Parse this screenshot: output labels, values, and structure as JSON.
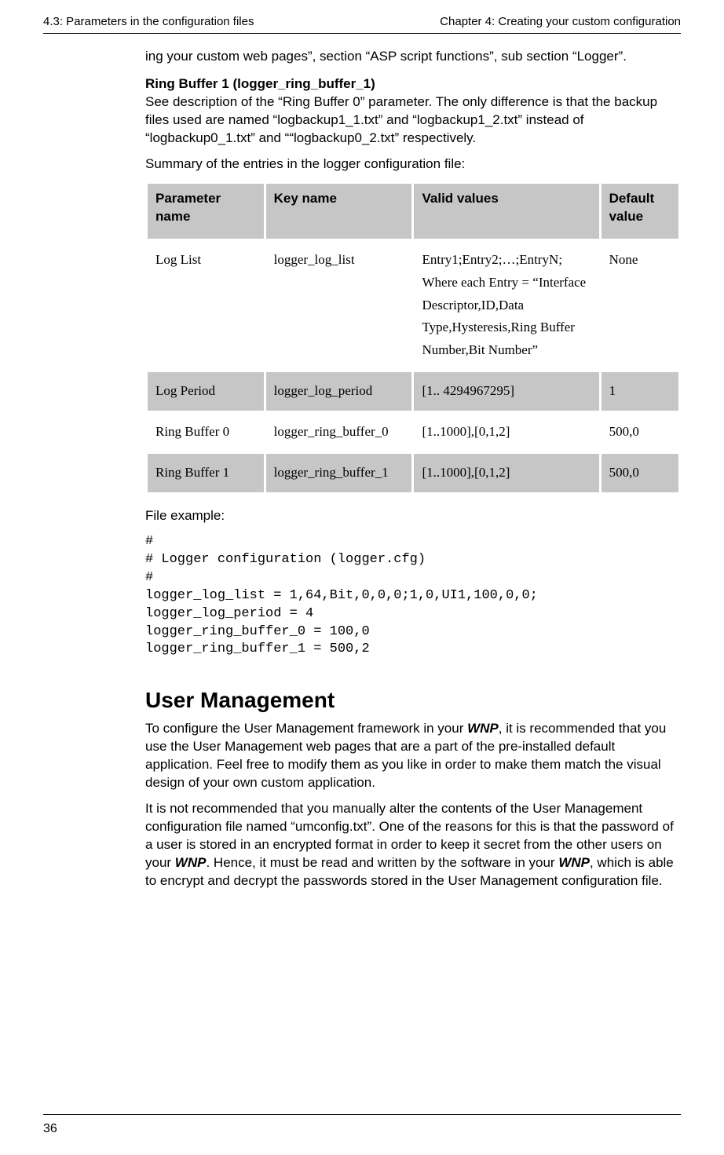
{
  "header": {
    "left": "4.3: Parameters in the configuration files",
    "right": "Chapter 4: Creating your custom configuration"
  },
  "intro": {
    "cont": "ing your custom web pages”, section “ASP script functions”, sub section “Logger”."
  },
  "ringbuffer1": {
    "heading": "Ring Buffer 1 (logger_ring_buffer_1)",
    "body": "See description of the “Ring Buffer 0” parameter. The only difference is that the backup files used are named “logbackup1_1.txt” and “logbackup1_2.txt” instead of “logbackup0_1.txt” and ““logbackup0_2.txt” respectively."
  },
  "summary_line": "Summary of the entries in the logger configuration file:",
  "table": {
    "headers": {
      "param": "Parameter name",
      "key": "Key name",
      "valid": "Valid values",
      "def": "Default value"
    },
    "rows": [
      {
        "param": "Log List",
        "key": "logger_log_list",
        "valid": "Entry1;Entry2;…;EntryN; Where each Entry = “Interface Descriptor,ID,Data Type,Hysteresis,Ring Buffer Number,Bit Number”",
        "def": "None"
      },
      {
        "param": "Log Period",
        "key": "logger_log_period",
        "valid": "[1.. 4294967295]",
        "def": "1"
      },
      {
        "param": "Ring Buffer 0",
        "key": "logger_ring_buffer_0",
        "valid": "[1..1000],[0,1,2]",
        "def": "500,0"
      },
      {
        "param": "Ring Buffer 1",
        "key": "logger_ring_buffer_1",
        "valid": "[1..1000],[0,1,2]",
        "def": "500,0"
      }
    ]
  },
  "file_example_label": "File example:",
  "code": "#\n# Logger configuration (logger.cfg)\n#\nlogger_log_list = 1,64,Bit,0,0,0;1,0,UI1,100,0,0;\nlogger_log_period = 4\nlogger_ring_buffer_0 = 100,0\nlogger_ring_buffer_1 = 500,2",
  "usermgmt": {
    "heading": "User Management",
    "p1_a": "To configure the User Management framework in your ",
    "p1_w1": "WNP",
    "p1_b": ", it is recommended that you use the User Management web pages that are a part of the pre-installed default application. Feel free to modify them as you like in order to make them match the visual design of your own custom application.",
    "p2_a": "It is not recommended that you manually alter the contents of the User Management configuration file named “umconfig.txt”. One of the reasons for this is that the password of a user is stored in an encrypted format in order to keep it secret from the other users on your ",
    "p2_w1": "WNP",
    "p2_b": ". Hence, it must be read and written by the software in your ",
    "p2_w2": "WNP",
    "p2_c": ", which is able to encrypt and decrypt the passwords stored in the User Management configuration file."
  },
  "footer": {
    "page_number": "36"
  }
}
